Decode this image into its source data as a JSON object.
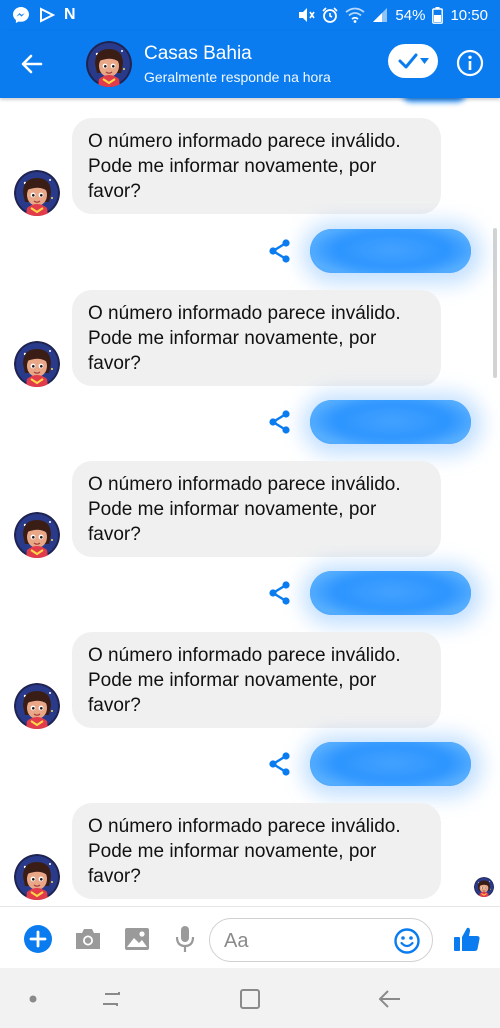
{
  "status_bar": {
    "carrier_icon": "N",
    "battery_percent": "54%",
    "time": "10:50"
  },
  "header": {
    "title": "Casas Bahia",
    "subtitle": "Geralmente responde na hora"
  },
  "messages": [
    {
      "from": "bot",
      "text": "O número informado parece inválido. Pode me informar novamente, por favor?"
    },
    {
      "from": "user",
      "text": "",
      "redacted": true
    },
    {
      "from": "bot",
      "text": "O número informado parece inválido. Pode me informar novamente, por favor?"
    },
    {
      "from": "user",
      "text": "",
      "redacted": true
    },
    {
      "from": "bot",
      "text": "O número informado parece inválido. Pode me informar novamente, por favor?"
    },
    {
      "from": "user",
      "text": "",
      "redacted": true
    },
    {
      "from": "bot",
      "text": "O número informado parece inválido. Pode me informar novamente, por favor?"
    },
    {
      "from": "user",
      "text": "",
      "redacted": true
    },
    {
      "from": "bot",
      "text": "O número informado parece inválido. Pode me informar novamente, por favor?"
    }
  ],
  "composer": {
    "placeholder": "Aa"
  },
  "colors": {
    "brand_blue": "#0a7cf0",
    "bubble_gray": "#f0f0f0"
  },
  "icons": [
    "messenger-icon",
    "play-icon",
    "back-arrow-icon",
    "check-icon",
    "info-icon",
    "share-icon",
    "plus-icon",
    "camera-icon",
    "image-icon",
    "mic-icon",
    "emoji-icon",
    "like-icon",
    "recents-icon",
    "home-icon",
    "nav-back-icon"
  ]
}
